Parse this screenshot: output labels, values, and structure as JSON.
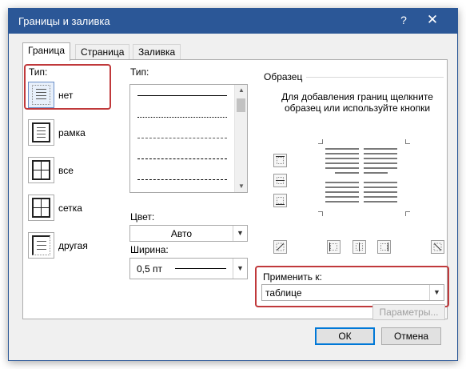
{
  "window": {
    "title": "Границы и заливка",
    "help_glyph": "?",
    "close_glyph": "✕"
  },
  "tabs": [
    {
      "label": "Граница",
      "active": true
    },
    {
      "label": "Страница",
      "active": false
    },
    {
      "label": "Заливка",
      "active": false
    }
  ],
  "setting": {
    "label": "Тип:",
    "items": [
      {
        "label": "нет",
        "selected": true
      },
      {
        "label": "рамка",
        "selected": false
      },
      {
        "label": "все",
        "selected": false
      },
      {
        "label": "сетка",
        "selected": false
      },
      {
        "label": "другая",
        "selected": false
      }
    ]
  },
  "line_style": {
    "label": "Тип:",
    "styles": [
      "solid",
      "dotted",
      "dashed-fine",
      "dashed",
      "dash-dot"
    ]
  },
  "color": {
    "label": "Цвет:",
    "value": "Авто"
  },
  "width": {
    "label": "Ширина:",
    "value": "0,5 пт"
  },
  "preview": {
    "label": "Образец",
    "hint": "Для добавления границ щелкните образец или используйте кнопки"
  },
  "apply_to": {
    "label": "Применить к:",
    "value": "таблице"
  },
  "buttons": {
    "options": "Параметры...",
    "ok": "ОК",
    "cancel": "Отмена"
  },
  "colors": {
    "titlebar": "#2b5797",
    "highlight": "#c0393b",
    "default_button_border": "#0078d7"
  }
}
